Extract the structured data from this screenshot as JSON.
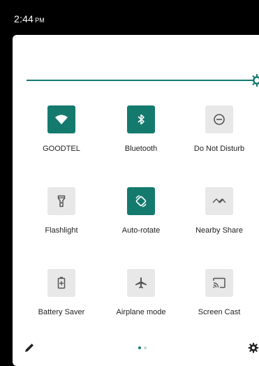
{
  "status_bar": {
    "time": "2:44",
    "ampm": "PM"
  },
  "brightness": {
    "level": 0.98
  },
  "tiles": [
    {
      "label": "GOODTEL",
      "icon": "wifi-icon",
      "state": "on"
    },
    {
      "label": "Bluetooth",
      "icon": "bluetooth-icon",
      "state": "on"
    },
    {
      "label": "Do Not Disturb",
      "icon": "do-not-disturb-icon",
      "state": "off"
    },
    {
      "label": "Flashlight",
      "icon": "flashlight-icon",
      "state": "off"
    },
    {
      "label": "Auto-rotate",
      "icon": "auto-rotate-icon",
      "state": "on"
    },
    {
      "label": "Nearby Share",
      "icon": "nearby-share-icon",
      "state": "off"
    },
    {
      "label": "Battery Saver",
      "icon": "battery-saver-icon",
      "state": "off"
    },
    {
      "label": "Airplane mode",
      "icon": "airplane-icon",
      "state": "off"
    },
    {
      "label": "Screen Cast",
      "icon": "screen-cast-icon",
      "state": "off"
    }
  ],
  "pager": {
    "pages": 2,
    "current": 1
  },
  "colors": {
    "accent": "#157a6e",
    "inactive_tile": "#e8e8e8",
    "icon_dark": "#555555"
  }
}
